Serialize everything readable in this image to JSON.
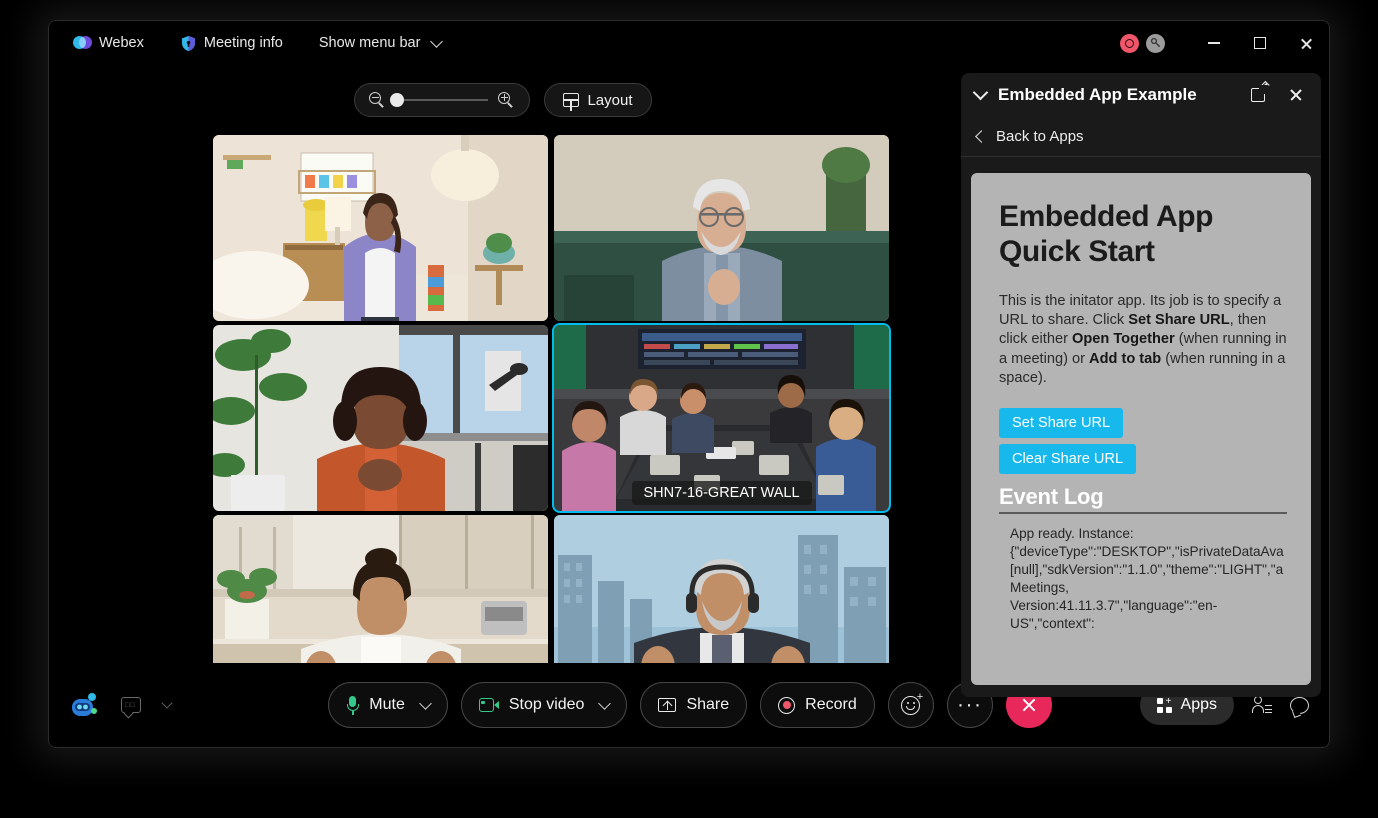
{
  "titlebar": {
    "app_name": "Webex",
    "meeting_info": "Meeting info",
    "show_menu_bar": "Show menu bar",
    "recording_indicator": "recording-indicator",
    "lock_indicator": "encryption-key-indicator",
    "minimize": "Minimize",
    "maximize": "Maximize",
    "close": "Close"
  },
  "stage": {
    "zoom_out_label": "Zoom out",
    "zoom_in_label": "Zoom in",
    "zoom_value": "0",
    "layout_label": "Layout",
    "tiles": [
      {
        "id": "tile-1",
        "label": "",
        "active": false
      },
      {
        "id": "tile-2",
        "label": "",
        "active": false
      },
      {
        "id": "tile-3",
        "label": "",
        "active": false
      },
      {
        "id": "tile-4",
        "label": "SHN7-16-GREAT WALL",
        "active": true
      },
      {
        "id": "tile-5",
        "label": "",
        "active": false
      },
      {
        "id": "tile-6",
        "label": "",
        "active": false
      }
    ],
    "active_tile_border_color": "#00BCEB"
  },
  "toolbar": {
    "assistant_label": "assistant-avatar",
    "captions_label": "closed-captions",
    "mute_label": "Mute",
    "stop_video_label": "Stop video",
    "share_label": "Share",
    "record_label": "Record",
    "reactions_label": "Reactions",
    "more_label": "More options",
    "leave_label": "Leave meeting",
    "apps_label": "Apps",
    "participants_label": "Participants",
    "chat_label": "Chat",
    "mic_on_color": "#34C98B",
    "record_dot_color": "#F0566A",
    "leave_color": "#E8285A"
  },
  "panel": {
    "title": "Embedded App Example",
    "back_label": "Back to Apps",
    "popout_label": "Open in new window",
    "close_label": "Close panel",
    "collapse_label": "Collapse panel"
  },
  "app": {
    "heading_line1": "Embedded App",
    "heading_line2": "Quick Start",
    "intro_1": "This is the initator app. Its job is to specify a URL to share. Click ",
    "intro_b1": "Set Share URL",
    "intro_2": ", then click either ",
    "intro_b2": "Open Together",
    "intro_3": " (when running in a meeting) or ",
    "intro_b3": "Add to tab",
    "intro_4": " (when running in a space).",
    "set_share_url_label": "Set Share URL",
    "clear_share_url_label": "Clear Share URL",
    "event_log_title": "Event Log",
    "event_log_text": "App ready. Instance:\n{\"deviceType\":\"DESKTOP\",\"isPrivateDataAva\n[null],\"sdkVersion\":\"1.1.0\",\"theme\":\"LIGHT\",\"a\nMeetings,\nVersion:41.11.3.7\",\"language\":\"en-\nUS\",\"context\":",
    "accent_color": "#17B9EC",
    "surface_color": "#B4B4B4"
  }
}
